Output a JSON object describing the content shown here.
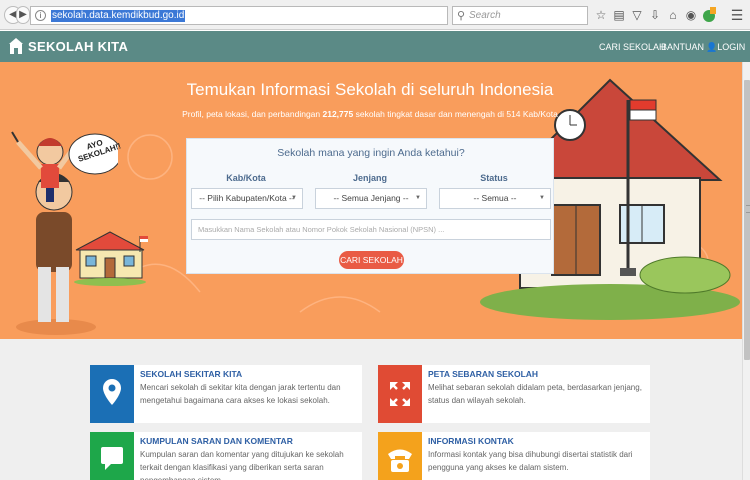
{
  "browser": {
    "url": "sekolah.data.kemdikbud.go.id",
    "search_placeholder": "Search"
  },
  "navbar": {
    "brand": "SEKOLAH KITA",
    "links": [
      "CARI SEKOLAH",
      "BANTUAN",
      "LOGIN"
    ]
  },
  "hero": {
    "title": "Temukan Informasi Sekolah di seluruh Indonesia",
    "subtitle_before": "Profil, peta lokasi, dan perbandingan ",
    "subtitle_count": "212,775",
    "subtitle_after": " sekolah tingkat dasar dan menengah di 514 Kab/Kota",
    "speech_bubble": "AYO SEKOLAH!!"
  },
  "search_panel": {
    "title": "Sekolah mana yang ingin Anda ketahui?",
    "columns": [
      {
        "label": "Kab/Kota",
        "selected": "-- Pilih Kabupaten/Kota --"
      },
      {
        "label": "Jenjang",
        "selected": "-- Semua Jenjang --"
      },
      {
        "label": "Status",
        "selected": "-- Semua --"
      }
    ],
    "input_placeholder": "Masukkan Nama Sekolah atau Nomor Pokok Sekolah Nasional (NPSN) ...",
    "button_label": "CARI SEKOLAH"
  },
  "cards": [
    {
      "title": "SEKOLAH SEKITAR KITA",
      "desc": "Mencari sekolah di sekitar kita dengan jarak tertentu dan mengetahui bagaimana cara akses ke lokasi sekolah.",
      "icon": "map-pin-icon",
      "color": "#1b6fb5"
    },
    {
      "title": "PETA SEBARAN SEKOLAH",
      "desc": "Melihat sebaran sekolah didalam peta, berdasarkan jenjang, status dan wilayah sekolah.",
      "icon": "expand-arrows-icon",
      "color": "#e04b34"
    },
    {
      "title": "KUMPULAN SARAN DAN KOMENTAR",
      "desc": "Kumpulan saran dan komentar yang ditujukan ke sekolah terkait dengan klasifikasi yang diberikan serta saran pengembangan sistem.",
      "icon": "speech-bubble-icon",
      "color": "#1ea74a"
    },
    {
      "title": "INFORMASI KONTAK",
      "desc": "Informasi kontak yang bisa dihubungi disertai statistik dari pengguna yang akses ke dalam sistem.",
      "icon": "telephone-icon",
      "color": "#f4a21c"
    }
  ]
}
